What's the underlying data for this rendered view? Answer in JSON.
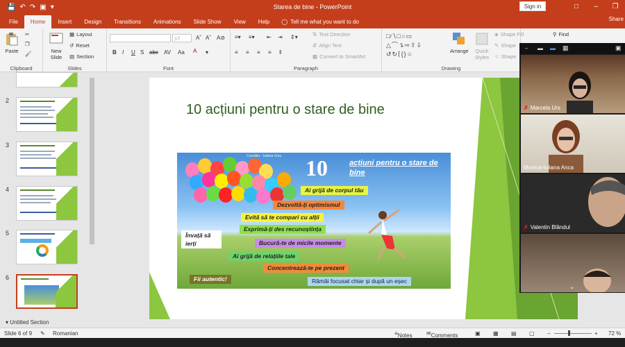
{
  "window": {
    "title": "Starea de bine - PowerPoint",
    "signin": "Sign in",
    "share": "Share"
  },
  "tabs": [
    "File",
    "Home",
    "Insert",
    "Design",
    "Transitions",
    "Animations",
    "Slide Show",
    "View",
    "Help"
  ],
  "tellme": "Tell me what you want to do",
  "ribbon": {
    "clipboard": {
      "label": "Clipboard",
      "paste": "Paste"
    },
    "slides": {
      "label": "Slides",
      "new_slide": "New Slide",
      "layout": "Layout",
      "reset": "Reset",
      "section": "Section"
    },
    "font": {
      "label": "Font",
      "size": "17"
    },
    "paragraph": {
      "label": "Paragraph",
      "text_direction": "Text Direction",
      "align_text": "Align Text",
      "convert": "Convert to SmartArt"
    },
    "drawing": {
      "label": "Drawing",
      "arrange": "Arrange",
      "quick_styles": "Quick Styles",
      "shape_fill": "Shape Fill",
      "shape_outline": "Shape",
      "shape_effects": "Shape",
      "find": "Find"
    }
  },
  "thumbnails": [
    {
      "num": "2",
      "title": "Cum ne simțim de bine? (1)"
    },
    {
      "num": "3",
      "title": "Cu cine simțim de bine? (2)"
    },
    {
      "num": "4",
      "title": "Cu cine simțim de bine? (3)"
    },
    {
      "num": "5",
      "title": "Modelul PERMA pentru starea de bine"
    },
    {
      "num": "6",
      "title": "10 acțiuni pentru o stare de bine"
    }
  ],
  "section_label": "Untitled Section",
  "slide": {
    "title": "10 acțiuni pentru o stare de bine",
    "poster": {
      "credit": "Consilier : Iuliana Ursu",
      "number": "10",
      "headline": "acțiuni pentru o stare de bine",
      "items": [
        "Ai grijă de corpul tău",
        "Dezvoltă-ți optimismul",
        "Evită să te compari cu alții",
        "Exprimă-ți des recunoștința",
        "Bucură-te de micile momente",
        "Ai grijă de relațiile tale",
        "Concentrează-te pe prezent",
        "Rămâi focusat chiar și după un eșec"
      ],
      "side_left": "Învață să ierți",
      "bottom_left": "Fii autentic!"
    }
  },
  "participants": [
    {
      "name": "Marcela Urs",
      "muted": true
    },
    {
      "name": "Monica-Iuliana Anca",
      "muted": false
    },
    {
      "name": "Valentin Blândul",
      "muted": true
    },
    {
      "name": "",
      "muted": false
    }
  ],
  "statusbar": {
    "slide_info": "Slide 6 of 9",
    "language": "Romanian",
    "notes": "Notes",
    "comments": "Comments",
    "zoom": "72 %"
  }
}
